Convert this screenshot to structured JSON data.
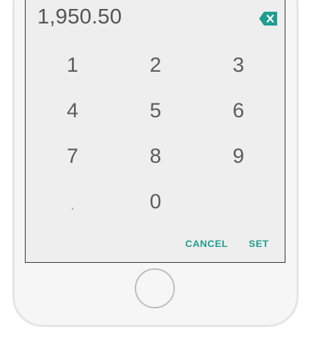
{
  "display": {
    "value": "1,950.50"
  },
  "icons": {
    "backspace": "backspace-icon"
  },
  "keypad": {
    "keys": [
      "1",
      "2",
      "3",
      "4",
      "5",
      "6",
      "7",
      "8",
      "9",
      ".",
      "0"
    ]
  },
  "actions": {
    "cancel_label": "CANCEL",
    "set_label": "SET"
  },
  "colors": {
    "accent": "#1f9e8f",
    "screen_bg": "#eeeeee",
    "phone_bg": "#f6f6f6"
  }
}
